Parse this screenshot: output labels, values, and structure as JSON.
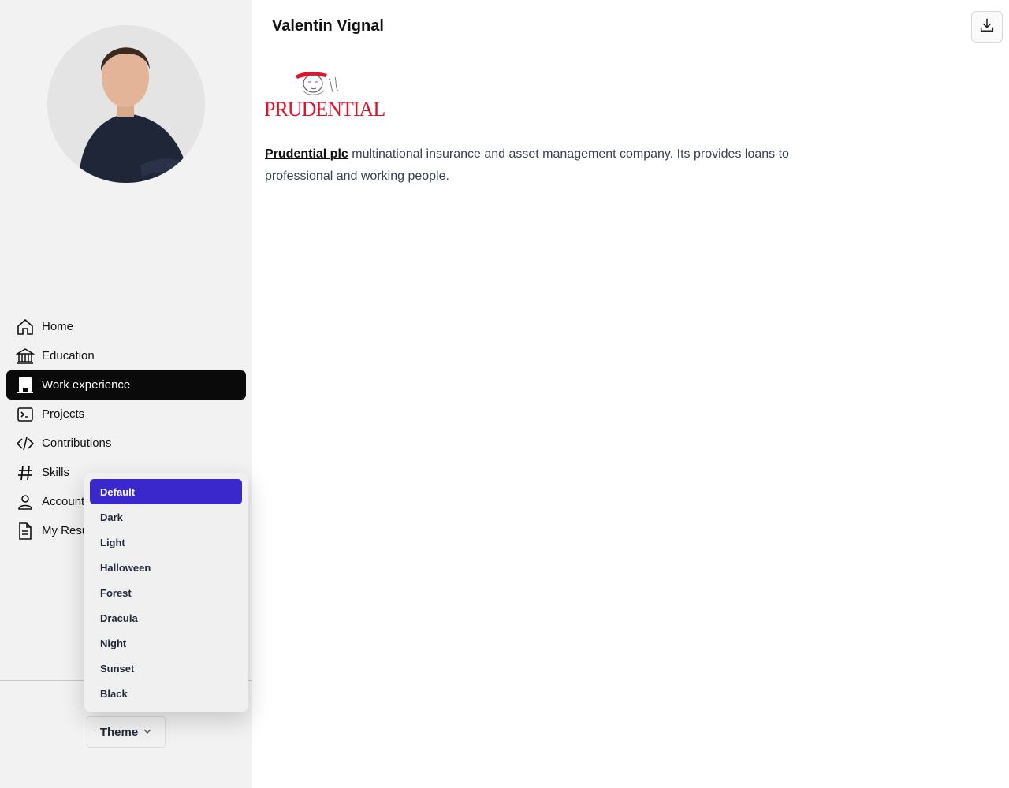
{
  "profile": {
    "name": "Valentin Vignal"
  },
  "nav": {
    "items": [
      {
        "label": "Home",
        "icon": "home-icon"
      },
      {
        "label": "Education",
        "icon": "bank-icon"
      },
      {
        "label": "Work experience",
        "icon": "building-icon",
        "active": true
      },
      {
        "label": "Projects",
        "icon": "terminal-icon"
      },
      {
        "label": "Contributions",
        "icon": "code-icon"
      },
      {
        "label": "Skills",
        "icon": "hashtag-icon"
      },
      {
        "label": "Account",
        "icon": "user-icon"
      },
      {
        "label": "My Resu",
        "icon": "document-icon"
      }
    ]
  },
  "theme": {
    "button_label": "Theme",
    "options": [
      "Default",
      "Dark",
      "Light",
      "Halloween",
      "Forest",
      "Dracula",
      "Night",
      "Sunset",
      "Black"
    ],
    "selected": "Default",
    "accent": "#3b28cc"
  },
  "company": {
    "logo_text": "PRUDENTIAL",
    "link_text": "Prudential plc",
    "description": " multinational insurance and asset management company. Its provides loans to professional and working people.",
    "brand_color": "#e0152b"
  }
}
